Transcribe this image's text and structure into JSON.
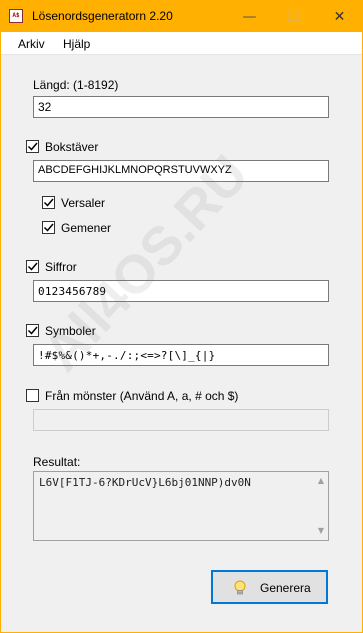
{
  "window": {
    "title": "Lösenordsgeneratorn 2.20",
    "app_icon_text": "A$",
    "accent_color": "#ffb000"
  },
  "menu": {
    "items": [
      "Arkiv",
      "Hjälp"
    ]
  },
  "length": {
    "label": "Längd: (1-8192)",
    "value": "32"
  },
  "letters": {
    "label": "Bokstäver",
    "checked": true,
    "value": "ABCDEFGHIJKLMNOPQRSTUVWXYZ",
    "uppercase": {
      "label": "Versaler",
      "checked": true
    },
    "lowercase": {
      "label": "Gemener",
      "checked": true
    }
  },
  "digits": {
    "label": "Siffror",
    "checked": true,
    "value": "0123456789"
  },
  "symbols": {
    "label": "Symboler",
    "checked": true,
    "value": "!#$%&()*+,-./:;<=>?[\\]_{|}"
  },
  "pattern": {
    "label": "Från mönster (Använd A, a, # och $)",
    "checked": false,
    "value": ""
  },
  "result": {
    "label": "Resultat:",
    "value": "L6V[F1TJ-6?KDrUcV}L6bj01NNP)dv0N"
  },
  "generate": {
    "label": "Generera",
    "icon": "lightbulb-icon"
  },
  "watermark": {
    "text": "All4OS.RU"
  }
}
